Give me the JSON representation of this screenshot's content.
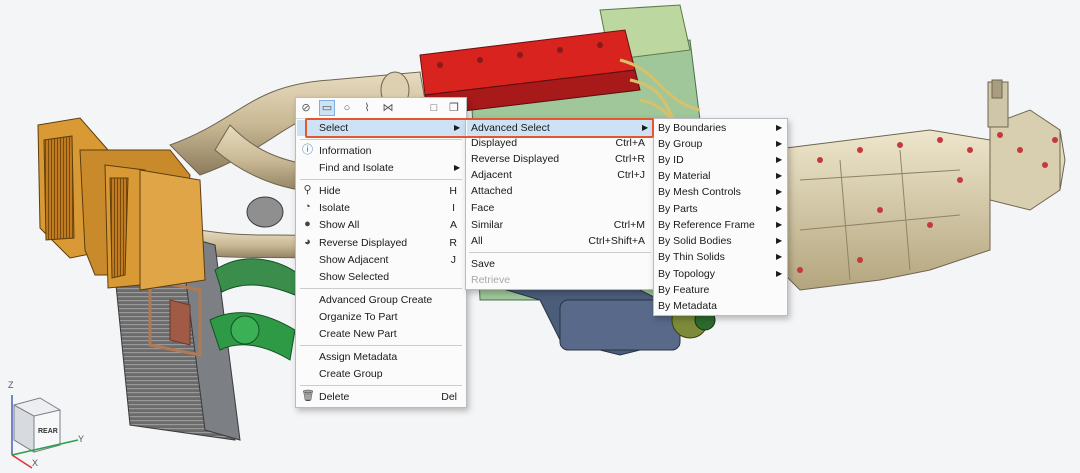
{
  "colors": {
    "accent_highlight": "#cde3f5",
    "callout": "#e4572e"
  },
  "toolbar": {
    "icons": [
      "cancel-icon",
      "rectangle-select-icon",
      "circle-select-icon",
      "freehand-select-icon",
      "polygon-select-icon",
      "window-icon",
      "copy-icon"
    ]
  },
  "context_menu": {
    "select": "Select",
    "information": "Information",
    "find_and_isolate": "Find and Isolate",
    "hide": "Hide",
    "hide_sc": "H",
    "isolate": "Isolate",
    "isolate_sc": "I",
    "show_all": "Show All",
    "show_all_sc": "A",
    "reverse_displayed": "Reverse Displayed",
    "reverse_displayed_sc": "R",
    "show_adjacent": "Show Adjacent",
    "show_adjacent_sc": "J",
    "show_selected": "Show Selected",
    "advanced_group_create": "Advanced Group Create",
    "organize_to_part": "Organize To Part",
    "create_new_part": "Create New Part",
    "assign_metadata": "Assign Metadata",
    "create_group": "Create Group",
    "delete": "Delete",
    "delete_sc": "Del"
  },
  "select_menu": {
    "advanced_select": "Advanced Select",
    "displayed": "Displayed",
    "displayed_sc": "Ctrl+A",
    "reverse_displayed": "Reverse Displayed",
    "reverse_displayed_sc": "Ctrl+R",
    "adjacent": "Adjacent",
    "adjacent_sc": "Ctrl+J",
    "attached": "Attached",
    "face": "Face",
    "similar": "Similar",
    "similar_sc": "Ctrl+M",
    "all": "All",
    "all_sc": "Ctrl+Shift+A",
    "save": "Save",
    "retrieve": "Retrieve"
  },
  "advanced_menu": {
    "items": [
      "By Boundaries",
      "By Group",
      "By ID",
      "By Material",
      "By Mesh Controls",
      "By Parts",
      "By Reference Frame",
      "By Solid Bodies",
      "By Thin Solids",
      "By Topology",
      "By Feature",
      "By Metadata"
    ]
  },
  "view_cube": {
    "face": "REAR",
    "axis_z": "Z",
    "axis_y": "Y",
    "axis_x": "X"
  }
}
